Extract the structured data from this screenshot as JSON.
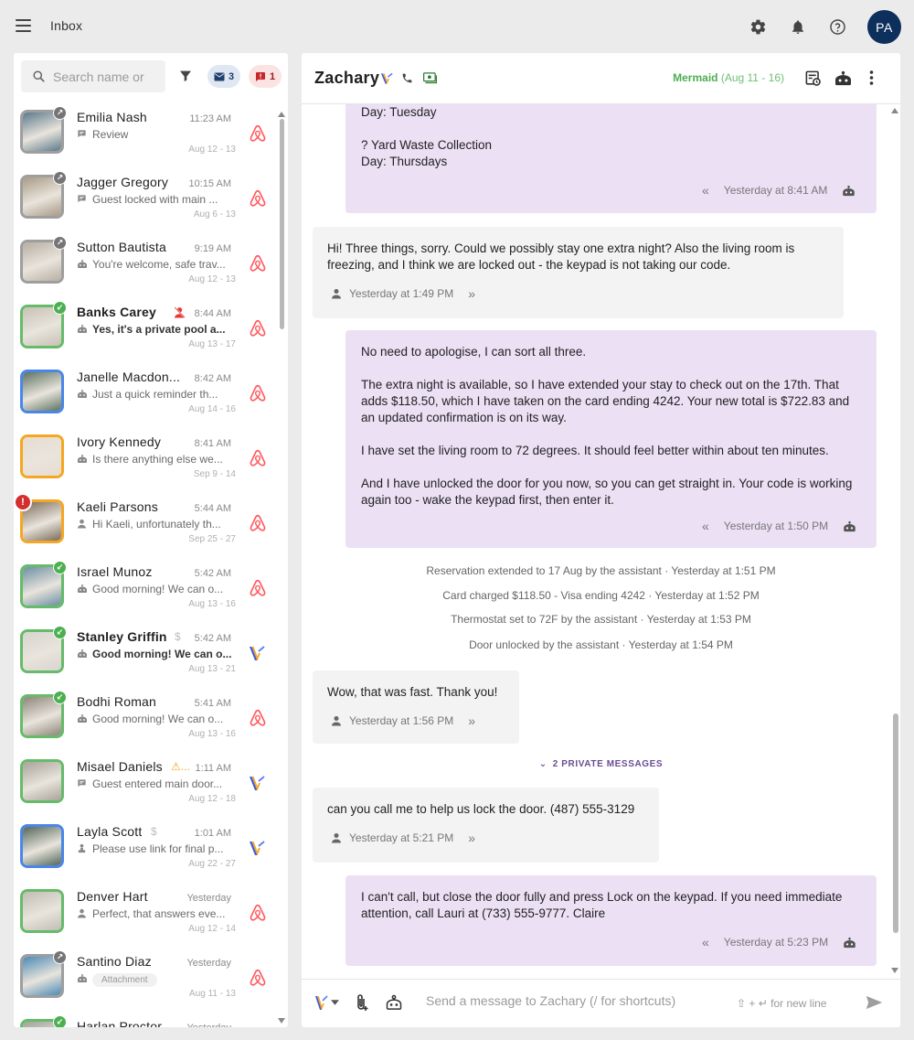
{
  "app": {
    "title": "Inbox",
    "user_initials": "PA"
  },
  "colors": {
    "accent_purple": "#ece0f5",
    "airbnb": "#ff5a5f",
    "green": "#4caf50",
    "navy": "#0d2f5c"
  },
  "search": {
    "placeholder": "Search name or"
  },
  "chips": {
    "unread": "3",
    "alerts": "1"
  },
  "conversations": [
    {
      "name": "Emilia Nash",
      "time": "11:23 AM",
      "preview": "Review",
      "dates": "Aug 12 - 13",
      "bold": false,
      "border": "#9e9e9e",
      "badge": "↗",
      "badge_color": "#757575",
      "channel": "airbnb",
      "pi": "note",
      "img": "#5b7a8c"
    },
    {
      "name": "Jagger Gregory",
      "time": "10:15 AM",
      "preview": "Guest locked with main ...",
      "dates": "Aug 6 - 13",
      "bold": false,
      "border": "#9e9e9e",
      "badge": "↗",
      "badge_color": "#757575",
      "channel": "airbnb",
      "pi": "note",
      "img": "#a89a86"
    },
    {
      "name": "Sutton Bautista",
      "time": "9:19 AM",
      "preview": "You're welcome, safe trav...",
      "dates": "Aug 12 - 13",
      "bold": false,
      "border": "#9e9e9e",
      "badge": "↗",
      "badge_color": "#757575",
      "channel": "airbnb",
      "pi": "bot",
      "img": "#b7aea2"
    },
    {
      "name": "Banks Carey",
      "time": "8:44 AM",
      "preview": "Yes, it's a private pool a...",
      "dates": "Aug 13 - 17",
      "bold": true,
      "border": "#66bb6a",
      "badge": "↙",
      "badge_color": "#4caf50",
      "channel": "airbnb",
      "pi": "bot",
      "img": "#c7c1b5",
      "extra": "person-off"
    },
    {
      "name": "Janelle Macdon...",
      "time": "8:42 AM",
      "preview": "Just a quick reminder th...",
      "dates": "Aug 14 - 16",
      "bold": false,
      "border": "#4a86e8",
      "badge": "",
      "channel": "airbnb",
      "pi": "bot",
      "img": "#5d7262"
    },
    {
      "name": "Ivory Kennedy",
      "time": "8:41 AM",
      "preview": "Is there anything else we...",
      "dates": "Sep 9 - 14",
      "bold": false,
      "border": "#f5a623",
      "badge": "",
      "channel": "airbnb",
      "pi": "bot",
      "img": "#e7ddd0"
    },
    {
      "name": "Kaeli Parsons",
      "time": "5:44 AM",
      "preview": "Hi Kaeli, unfortunately th...",
      "dates": "Sep 25 - 27",
      "bold": false,
      "border": "#f5a623",
      "badge": "",
      "channel": "airbnb",
      "pi": "person",
      "img": "#7a6b58",
      "alert": "!"
    },
    {
      "name": "Israel Munoz",
      "time": "5:42 AM",
      "preview": "Good morning! We can o...",
      "dates": "Aug 13 - 16",
      "bold": false,
      "border": "#66bb6a",
      "badge": "↙",
      "badge_color": "#4caf50",
      "channel": "airbnb",
      "pi": "bot",
      "img": "#6b8fa3"
    },
    {
      "name": "Stanley Griffin",
      "time": "5:42 AM",
      "preview": "Good morning! We can o...",
      "dates": "Aug 13 - 21",
      "bold": true,
      "border": "#66bb6a",
      "badge": "↙",
      "badge_color": "#4caf50",
      "channel": "vrbo",
      "pi": "bot",
      "img": "#d8d5cf",
      "extra": "$"
    },
    {
      "name": "Bodhi Roman",
      "time": "5:41 AM",
      "preview": "Good morning! We can o...",
      "dates": "Aug 13 - 16",
      "bold": false,
      "border": "#66bb6a",
      "badge": "↙",
      "badge_color": "#4caf50",
      "channel": "airbnb",
      "pi": "bot",
      "img": "#8c8579"
    },
    {
      "name": "Misael Daniels",
      "time": "1:11 AM",
      "preview": "Guest entered main door...",
      "dates": "Aug 12 - 18",
      "bold": false,
      "border": "#66bb6a",
      "badge": "",
      "channel": "vrbo",
      "pi": "note",
      "img": "#a9a39a",
      "extra": "⚠..."
    },
    {
      "name": "Layla Scott",
      "time": "1:01 AM",
      "preview": "Please use link for final p...",
      "dates": "Aug 22 - 27",
      "bold": false,
      "border": "#4a86e8",
      "badge": "",
      "channel": "vrbo",
      "pi": "person2",
      "img": "#52665a",
      "extra": "$"
    },
    {
      "name": "Denver Hart",
      "time": "Yesterday",
      "preview": "Perfect, that answers eve...",
      "dates": "Aug 12 - 14",
      "bold": false,
      "border": "#66bb6a",
      "badge": "",
      "channel": "airbnb",
      "pi": "person",
      "img": "#c2bdb4"
    },
    {
      "name": "Santino Diaz",
      "time": "Yesterday",
      "preview": "",
      "attachment": "Attachment",
      "dates": "Aug 11 - 13",
      "bold": false,
      "border": "#9e9e9e",
      "badge": "↗",
      "badge_color": "#757575",
      "channel": "airbnb",
      "pi": "bot",
      "img": "#4c8bb5"
    },
    {
      "name": "Harlan Proctor",
      "time": "Yesterday",
      "preview": "",
      "dates": "",
      "bold": false,
      "border": "#66bb6a",
      "badge": "↙",
      "badge_color": "#4caf50",
      "channel": "airbnb",
      "pi": "",
      "img": "#9da39b"
    }
  ],
  "chat": {
    "guest_name": "Zachary",
    "listing_name": "Mermaid",
    "listing_dates": "(Aug 11 - 16)",
    "msg0_text": "Day: Tuesday\n\n? Yard Waste Collection\nDay: Thursdays",
    "msg0_time": "Yesterday at 8:41 AM",
    "msg1_text": "Hi! Three things, sorry. Could we possibly stay one extra night? Also the living room is freezing, and I think we are locked out - the keypad is not taking our code.",
    "msg1_time": "Yesterday at 1:49 PM",
    "msg2_text": "No need to apologise, I can sort all three.\n\nThe extra night is available, so I have extended your stay to check out on the 17th. That adds $118.50, which I have taken on the card ending 4242. Your new total is $722.83 and an updated confirmation is on its way.\n\nI have set the living room to 72 degrees. It should feel better within about ten minutes.\n\nAnd I have unlocked the door for you now, so you can get straight in. Your code is working again too - wake the keypad first, then enter it.",
    "msg2_time": "Yesterday at 1:50 PM",
    "sys1": "Reservation extended to 17 Aug by the assistant · Yesterday at 1:51 PM",
    "sys2": "Card charged $118.50 - Visa ending 4242 · Yesterday at 1:52 PM",
    "sys3": "Thermostat set to 72F by the assistant · Yesterday at 1:53 PM",
    "sys4": "Door unlocked by the assistant · Yesterday at 1:54 PM",
    "msg3_text": "Wow, that was fast. Thank you!",
    "msg3_time": "Yesterday at 1:56 PM",
    "private_label": "2 PRIVATE MESSAGES",
    "msg4_text": "can you call me to help us lock the door. (487) 555-3129",
    "msg4_time": "Yesterday at 5:21 PM",
    "msg5_text": "I can't call, but close the door fully and press Lock on the keypad. If you need immediate attention, call Lauri at (733) 555-9777. Claire",
    "msg5_time": "Yesterday at 5:23 PM",
    "composer_placeholder": "Send a message to Zachary (/ for shortcuts)",
    "composer_hint": "⇧ + ↵ for new line"
  }
}
